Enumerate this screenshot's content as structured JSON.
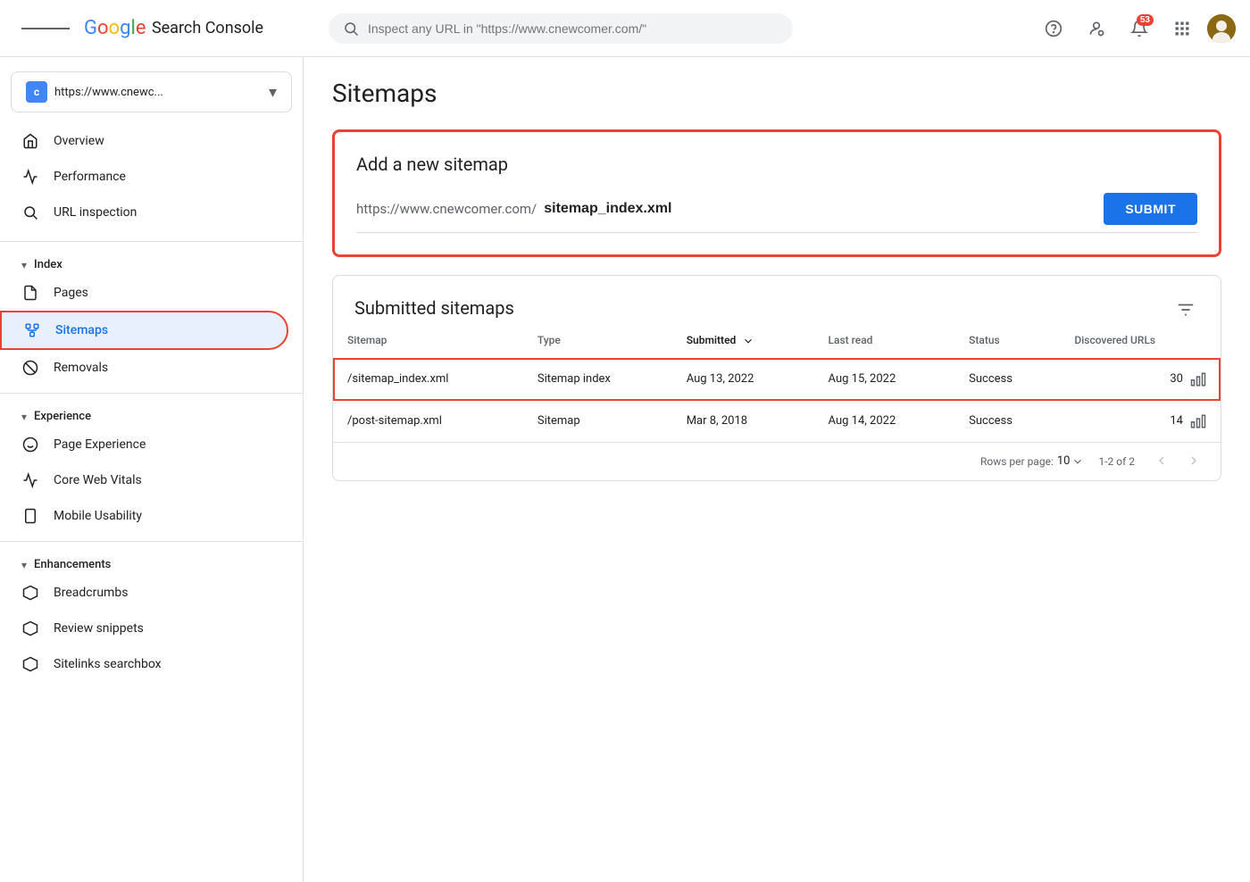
{
  "topbar": {
    "menu_icon": "menu-icon",
    "logo": {
      "g": "G",
      "o1": "o",
      "o2": "o",
      "g2": "g",
      "l": "l",
      "e": "e",
      "product": "Search Console"
    },
    "search_placeholder": "Inspect any URL in \"https://www.cnewcomer.com/\"",
    "notification_count": "53",
    "property": {
      "icon_label": "c",
      "name": "https://www.cnewc...",
      "arrow": "▾"
    }
  },
  "sidebar": {
    "property_name": "https://www.cnewc...",
    "nav": {
      "overview": "Overview",
      "performance": "Performance",
      "url_inspection": "URL inspection",
      "index_section": "Index",
      "pages": "Pages",
      "sitemaps": "Sitemaps",
      "removals": "Removals",
      "experience_section": "Experience",
      "page_experience": "Page Experience",
      "core_web_vitals": "Core Web Vitals",
      "mobile_usability": "Mobile Usability",
      "enhancements_section": "Enhancements",
      "breadcrumbs": "Breadcrumbs",
      "review_snippets": "Review snippets",
      "sitelinks_searchbox": "Sitelinks searchbox"
    }
  },
  "main": {
    "page_title": "Sitemaps",
    "add_sitemap": {
      "card_title": "Add a new sitemap",
      "base_url": "https://www.cnewcomer.com/",
      "input_value": "sitemap_index.xml",
      "submit_label": "SUBMIT"
    },
    "submitted_sitemaps": {
      "card_title": "Submitted sitemaps",
      "columns": {
        "sitemap": "Sitemap",
        "type": "Type",
        "submitted": "Submitted",
        "last_read": "Last read",
        "status": "Status",
        "discovered_urls": "Discovered URLs"
      },
      "rows": [
        {
          "sitemap": "/sitemap_index.xml",
          "type": "Sitemap index",
          "submitted": "Aug 13, 2022",
          "last_read": "Aug 15, 2022",
          "status": "Success",
          "discovered_urls": "30",
          "highlighted": true
        },
        {
          "sitemap": "/post-sitemap.xml",
          "type": "Sitemap",
          "submitted": "Mar 8, 2018",
          "last_read": "Aug 14, 2022",
          "status": "Success",
          "discovered_urls": "14",
          "highlighted": false
        }
      ],
      "pagination": {
        "rows_per_page_label": "Rows per page:",
        "rows_per_page_value": "10",
        "page_info": "1-2 of 2"
      }
    }
  }
}
